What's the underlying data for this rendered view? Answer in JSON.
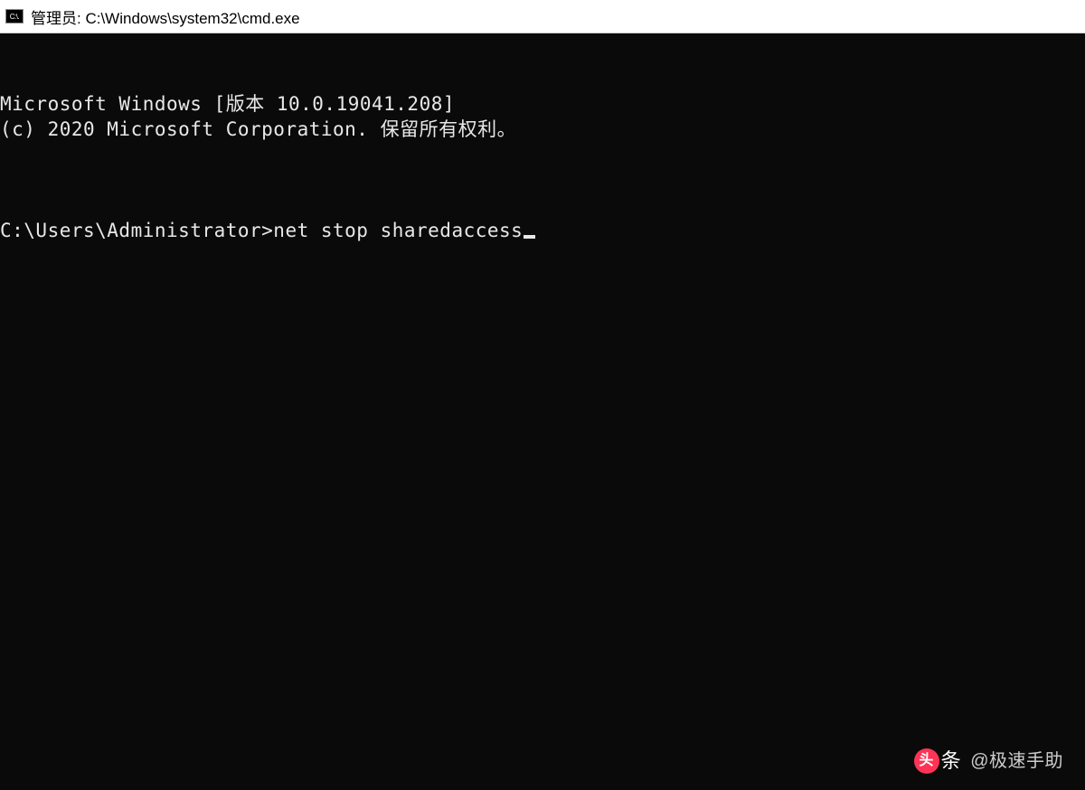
{
  "titlebar": {
    "icon_text": "C:\\.",
    "title": "管理员: C:\\Windows\\system32\\cmd.exe"
  },
  "terminal": {
    "line1": "Microsoft Windows [版本 10.0.19041.208]",
    "line2": "(c) 2020 Microsoft Corporation. 保留所有权利。",
    "prompt": "C:\\Users\\Administrator>",
    "command": "net stop sharedaccess"
  },
  "watermark": {
    "logo_char": "头",
    "logo_text": "条",
    "handle": "@极速手助"
  }
}
